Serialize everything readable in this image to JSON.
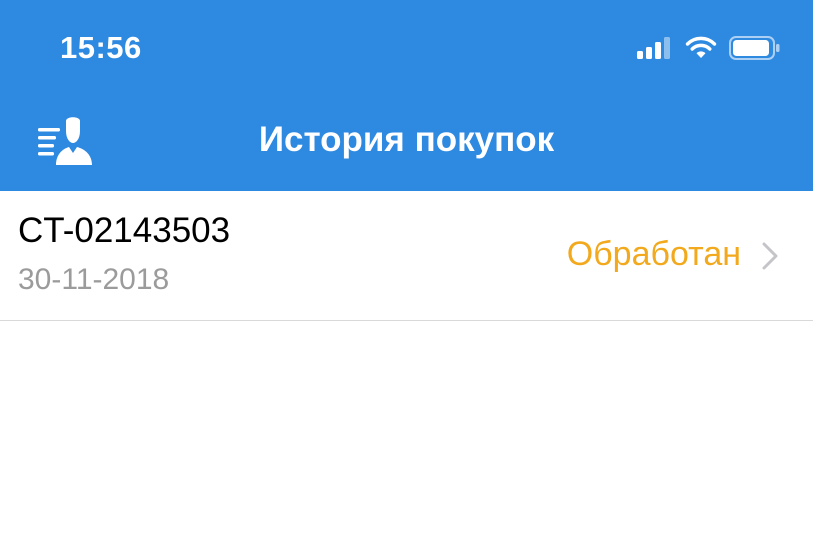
{
  "status_bar": {
    "time": "15:56",
    "icons": [
      "cellular-signal-icon",
      "wifi-icon",
      "battery-icon"
    ]
  },
  "nav": {
    "title": "История покупок",
    "menu_icon": "profile-list-icon"
  },
  "purchases": [
    {
      "number": "CT-02143503",
      "date": "30-11-2018",
      "status": "Обработан",
      "status_color": "#F2A91D"
    }
  ],
  "colors": {
    "header_bg": "#2E89E0",
    "header_text": "#ffffff",
    "date_text": "#9b9b9b",
    "status_text": "#F2A91D"
  }
}
